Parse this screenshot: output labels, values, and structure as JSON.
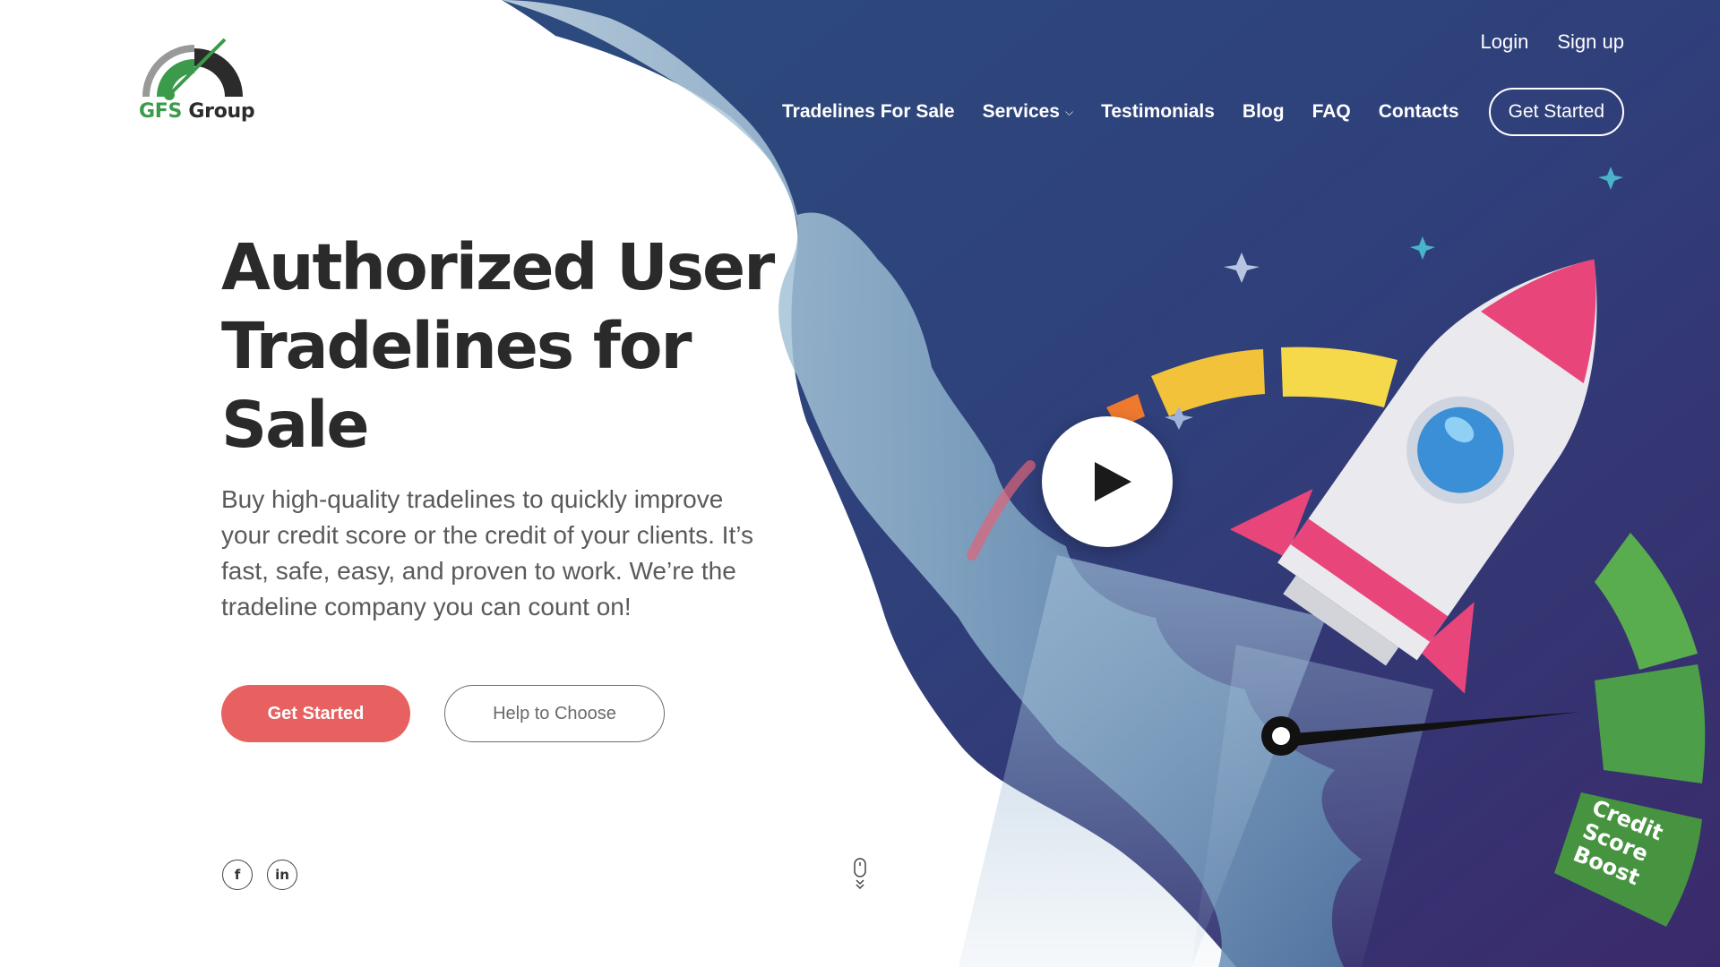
{
  "logo": {
    "brand": "GFS",
    "name": "Group"
  },
  "top_links": {
    "login": "Login",
    "signup": "Sign up"
  },
  "nav": {
    "items": [
      {
        "label": "Tradelines For Sale"
      },
      {
        "label": "Services"
      },
      {
        "label": "Testimonials"
      },
      {
        "label": "Blog"
      },
      {
        "label": "FAQ"
      },
      {
        "label": "Contacts"
      }
    ],
    "cta": "Get Started"
  },
  "hero": {
    "title": "Authorized User Tradelines for Sale",
    "subtitle": "Buy high-quality tradelines to quickly improve your credit score or the credit of your clients. It’s fast, safe, easy, and proven to work. We’re the tradeline company you can count on!",
    "primary_button": "Get Started",
    "secondary_button": "Help to Choose"
  },
  "badge": {
    "line1": "Credit",
    "line2": "Score",
    "line3": "Boost"
  },
  "colors": {
    "accent": "#e86161",
    "brand_green": "#3c9b4b",
    "sky_top": "#3b2a6b",
    "sky_mid": "#2f4f86",
    "rocket_pink": "#e8457a"
  },
  "icons": {
    "social": [
      "facebook-icon",
      "linkedin-icon"
    ],
    "scroll": "mouse-scroll-icon",
    "play": "play-icon"
  }
}
